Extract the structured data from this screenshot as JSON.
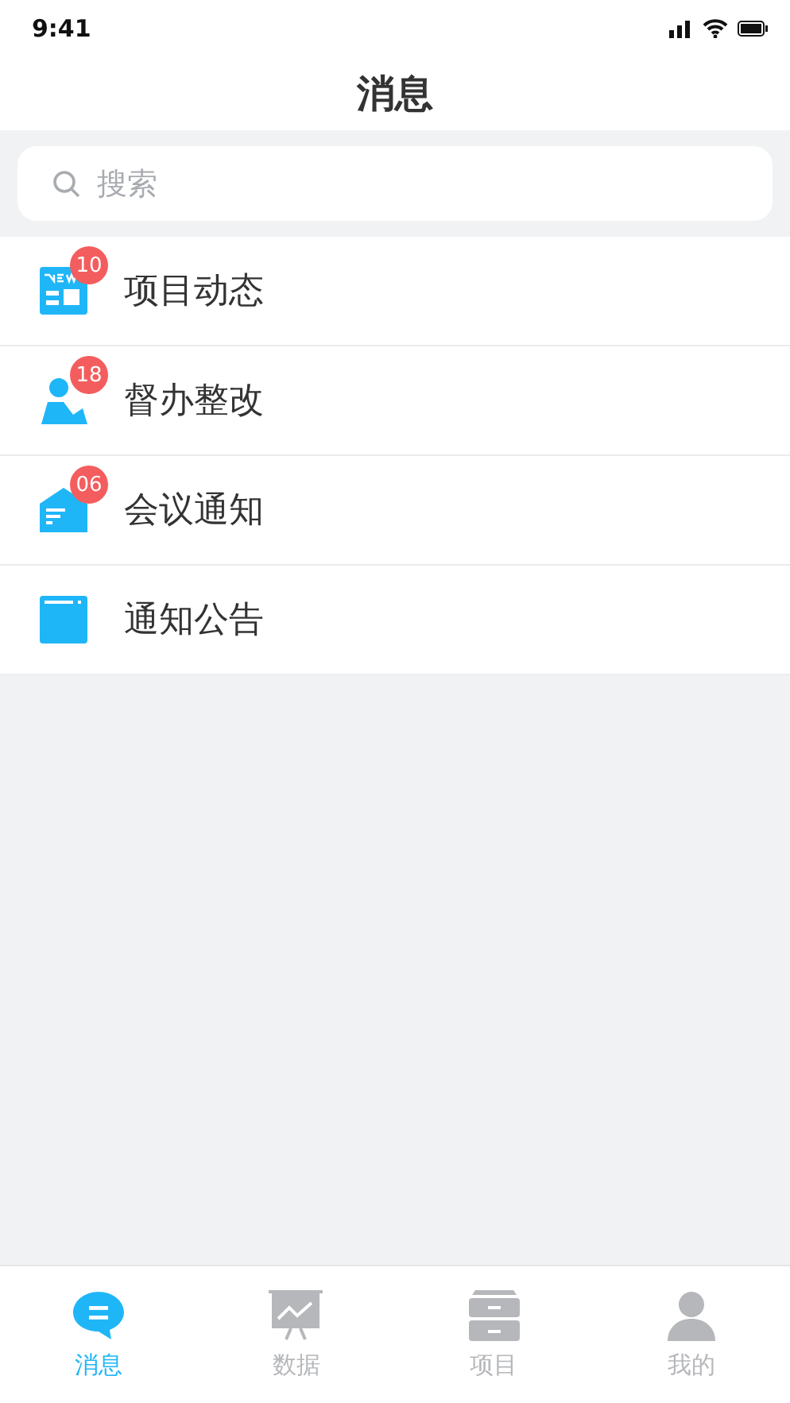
{
  "status_bar": {
    "time": "9:41"
  },
  "title": "消息",
  "search": {
    "placeholder": "搜索"
  },
  "items": [
    {
      "kind": "news",
      "label": "项目动态",
      "badge": "10"
    },
    {
      "kind": "person",
      "label": "督办整改",
      "badge": "18"
    },
    {
      "kind": "mail",
      "label": "会议通知",
      "badge": "06"
    },
    {
      "kind": "board",
      "label": "通知公告"
    }
  ],
  "tabs": [
    {
      "kind": "chat",
      "label": "消息",
      "selected": true
    },
    {
      "kind": "chart",
      "label": "数据",
      "selected": false
    },
    {
      "kind": "cabinet",
      "label": "项目",
      "selected": false
    },
    {
      "kind": "user",
      "label": "我的",
      "selected": false
    }
  ]
}
